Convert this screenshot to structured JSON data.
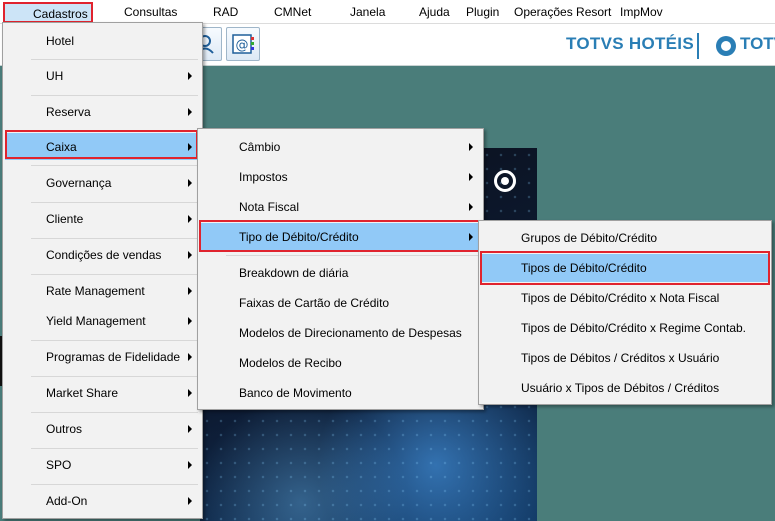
{
  "menubar": {
    "items": [
      "Cadastros",
      "Consultas",
      "RAD",
      "CMNet",
      "Janela",
      "Ajuda",
      "Plugin",
      "Operações Resort",
      "ImpMov"
    ]
  },
  "toolbar": {
    "buttons": [
      "help-user-icon",
      "email-at-icon"
    ]
  },
  "brand": {
    "name": "TOTVS HOTÉIS",
    "logo_text": "TOTV",
    "color": "#2a7eb5"
  },
  "menu_cadastros": {
    "items": [
      "Hotel",
      "UH",
      "Reserva",
      "Caixa",
      "Governança",
      "Cliente",
      "Condições de vendas",
      "Rate Management",
      "Yield Management",
      "Programas de Fidelidade",
      "Market Share",
      "Outros",
      "SPO",
      "Add-On"
    ]
  },
  "menu_caixa": {
    "items": [
      "Câmbio",
      "Impostos",
      "Nota Fiscal",
      "Tipo de Débito/Crédito",
      "Breakdown de diária",
      "Faixas de Cartão de Crédito",
      "Modelos de Direcionamento de Despesas",
      "Modelos de Recibo",
      "Banco de Movimento"
    ]
  },
  "menu_tipo": {
    "items": [
      "Grupos de Débito/Crédito",
      "Tipos de Débito/Crédito",
      "Tipos de Débito/Crédito x Nota Fiscal",
      "Tipos de Débito/Crédito x Regime Contab.",
      "Tipos de Débitos / Créditos x Usuário",
      "Usuário x Tipos de Débitos / Créditos"
    ]
  },
  "colors": {
    "highlight": "#91c9f7",
    "annotation": "#e0232e",
    "desktop": "#4a7d7a"
  }
}
